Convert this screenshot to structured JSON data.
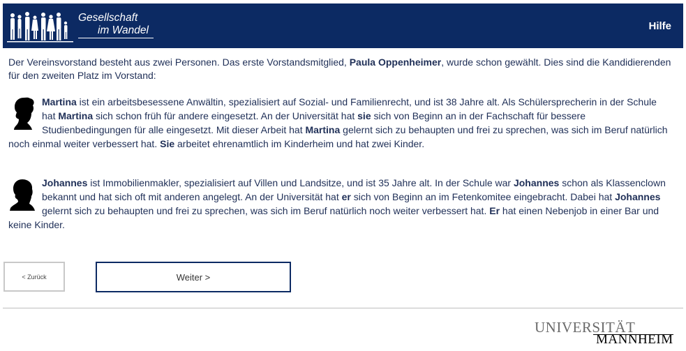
{
  "header": {
    "logo_line1": "Gesellschaft",
    "logo_line2": "im Wandel",
    "help_label": "Hilfe",
    "background_color": "#0c2a63"
  },
  "intro": {
    "t1": "Der Vereinsvorstand besteht aus zwei Personen. Das erste Vorstandsmitglied, ",
    "name": "Paula Oppenheimer",
    "t2": ", wurde schon gewählt. Dies sind die Kandidierenden für den zweiten Platz im Vorstand:"
  },
  "candidate1": {
    "icon": "female-silhouette-icon",
    "s1": "Martina",
    "s2": " ist ein arbeitsbesessene Anwältin, spezialisiert auf Sozial- und Familienrecht, und ist 38 Jahre alt. Als Schülersprecherin in der Schule hat ",
    "s3": "Martina",
    "s4": " sich schon früh für andere eingesetzt. An der Universität hat ",
    "s5": "sie",
    "s6": " sich von Beginn an in der Fachschaft für bessere Studienbedingungen für alle eingesetzt. Mit dieser Arbeit hat ",
    "s7": "Martina",
    "s8": " gelernt sich zu behaupten und frei zu sprechen, was sich im Beruf natürlich noch einmal weiter verbessert hat. ",
    "s9": "Sie",
    "s10": " arbeitet ehrenamtlich im Kinderheim und hat zwei Kinder."
  },
  "candidate2": {
    "icon": "male-silhouette-icon",
    "s1": "Johannes",
    "s2": " ist Immobilienmakler, spezialisiert auf Villen und Landsitze, und ist 35 Jahre alt. In der Schule war ",
    "s3": "Johannes",
    "s4": " schon als Klassenclown bekannt und hat sich oft mit anderen angelegt. An der Universität hat ",
    "s5": "er",
    "s6": " sich von Beginn an im Fetenkomitee eingebracht. Dabei hat ",
    "s7": "Johannes",
    "s8": " gelernt sich zu behaupten und frei zu sprechen, was sich im Beruf natürlich noch weiter verbessert hat. ",
    "s9": "Er",
    "s10": " hat einen Nebenjob in einer Bar und keine Kinder."
  },
  "nav": {
    "back_label": "< Zurück",
    "next_label": "Weiter >"
  },
  "footer": {
    "uni_line1": "UNIVERSITÄT",
    "uni_line2": "MANNHEIM"
  }
}
